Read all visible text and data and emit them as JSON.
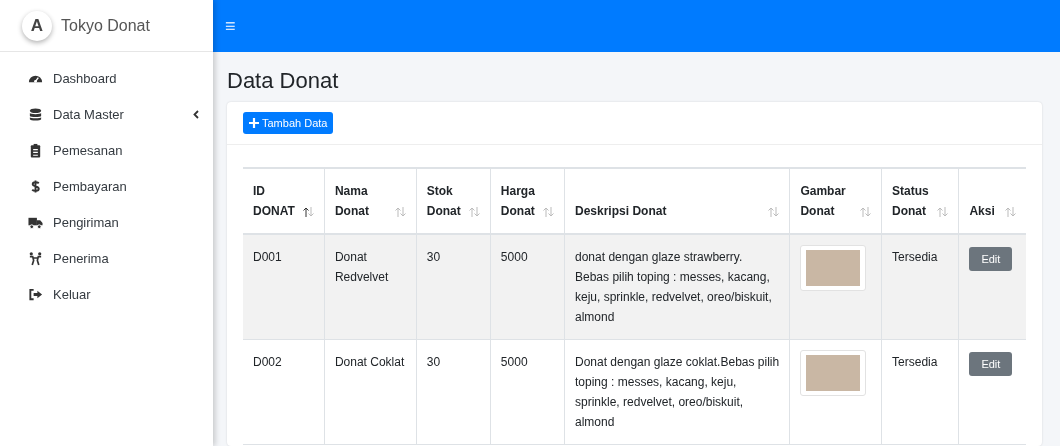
{
  "brand": {
    "logo": "A",
    "name": "Tokyo Donat"
  },
  "topbar": {
    "menu": "≡"
  },
  "sidebar": {
    "items": [
      {
        "label": "Dashboard",
        "expandable": false
      },
      {
        "label": "Data Master",
        "expandable": true
      },
      {
        "label": "Pemesanan",
        "expandable": false
      },
      {
        "label": "Pembayaran",
        "expandable": false
      },
      {
        "label": "Pengiriman",
        "expandable": false
      },
      {
        "label": "Penerima",
        "expandable": false
      },
      {
        "label": "Keluar",
        "expandable": false
      }
    ]
  },
  "page_title": "Data Donat",
  "add_button": "Tambah Data",
  "table": {
    "columns": [
      {
        "label": "ID DONAT",
        "sorted": true
      },
      {
        "label": "Nama Donat",
        "sorted": false
      },
      {
        "label": "Stok Donat",
        "sorted": false
      },
      {
        "label": "Harga Donat",
        "sorted": false
      },
      {
        "label": "Deskripsi Donat",
        "sorted": false
      },
      {
        "label": "Gambar Donat",
        "sorted": false
      },
      {
        "label": "Status Donat",
        "sorted": false
      },
      {
        "label": "Aksi",
        "sorted": false
      }
    ],
    "rows": [
      {
        "id": "D001",
        "name": "Donat Redvelvet",
        "stock": "30",
        "price": "5000",
        "description": "donat dengan glaze strawberry. Bebas pilih toping : messes, kacang, keju, sprinkle, redvelvet, oreo/biskuit, almond",
        "status": "Tersedia",
        "action": "Edit"
      },
      {
        "id": "D002",
        "name": "Donat Coklat",
        "stock": "30",
        "price": "5000",
        "description": "Donat dengan glaze coklat.Bebas pilih toping : messes, kacang, keju, sprinkle, redvelvet, oreo/biskuit, almond",
        "status": "Tersedia",
        "action": "Edit"
      }
    ]
  }
}
